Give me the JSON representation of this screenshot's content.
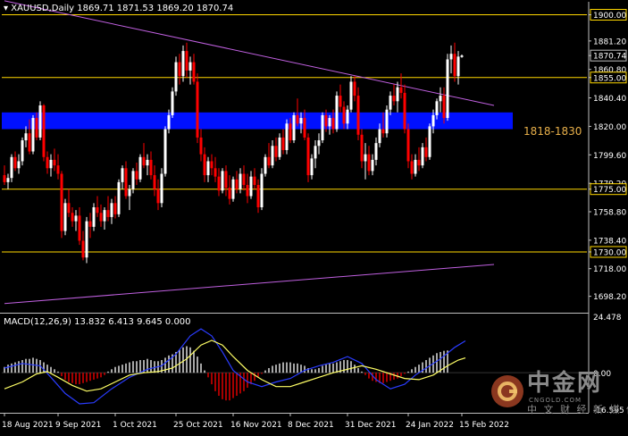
{
  "header": {
    "symbol": "XAUUSD,Daily",
    "ohlc": "1869.71 1871.53 1869.20 1870.74"
  },
  "macd": {
    "label": "MACD(12,26,9) 13.832 6.413 9.645 0.000",
    "axis_top": "24.478",
    "axis_zero": "0.00",
    "axis_bottom": "-16.595"
  },
  "zone_label": "1818-1830",
  "watermark": {
    "main": "中金网",
    "site": "CNGOLD.COM",
    "sub": "中 文 财 经 新 媒 体"
  },
  "colors": {
    "background": "#000000",
    "bull": "#ffffff",
    "bear": "#ff0000",
    "level_line": "#ffd700",
    "trendline": "#c060e0",
    "zone": "#0010ff",
    "macd_hist": "#ffffff",
    "macd_hist_neg": "#ff0000",
    "macd_line": "#2a3cff",
    "signal_line": "#ffff66"
  },
  "chart_data": {
    "type": "candlestick",
    "y_range": [
      1689,
      1908
    ],
    "price_ticks": [
      "1900.00",
      "1881.20",
      "1870.74",
      "1860.80",
      "1855.00",
      "1840.40",
      "1820.00",
      "1799.60",
      "1779.20",
      "1775.00",
      "1758.80",
      "1738.40",
      "1730.00",
      "1718.00",
      "1698.20"
    ],
    "levels": [
      1900,
      1855,
      1775,
      1730
    ],
    "level_labels": [
      "1900.00",
      "1855.00",
      "1775.00",
      "1730.00"
    ],
    "current_price": 1870.74,
    "current_price_label": "1870.74",
    "zone": {
      "low": 1818,
      "high": 1830,
      "label": "1818-1830"
    },
    "trendlines": [
      {
        "from_bar": 0,
        "from_price": 1910,
        "to_bar": 137,
        "to_price": 1835
      },
      {
        "from_bar": 0,
        "from_price": 1693,
        "to_bar": 137,
        "to_price": 1721
      }
    ],
    "x_ticks": [
      {
        "bar": 0,
        "label": "18 Aug 2021"
      },
      {
        "bar": 15,
        "label": "9 Sep 2021"
      },
      {
        "bar": 31,
        "label": "1 Oct 2021"
      },
      {
        "bar": 48,
        "label": "25 Oct 2021"
      },
      {
        "bar": 64,
        "label": "16 Nov 2021"
      },
      {
        "bar": 80,
        "label": "8 Dec 2021"
      },
      {
        "bar": 96,
        "label": "31 Dec 2021"
      },
      {
        "bar": 113,
        "label": "24 Jan 2022"
      },
      {
        "bar": 128,
        "label": "15 Feb 2022"
      }
    ],
    "candles": [
      [
        1785,
        1792,
        1778,
        1780
      ],
      [
        1780,
        1786,
        1775,
        1783
      ],
      [
        1783,
        1800,
        1780,
        1798
      ],
      [
        1798,
        1802,
        1788,
        1790
      ],
      [
        1790,
        1800,
        1786,
        1795
      ],
      [
        1795,
        1812,
        1792,
        1810
      ],
      [
        1810,
        1820,
        1805,
        1815
      ],
      [
        1815,
        1825,
        1800,
        1802
      ],
      [
        1802,
        1828,
        1800,
        1826
      ],
      [
        1826,
        1830,
        1810,
        1812
      ],
      [
        1812,
        1838,
        1810,
        1835
      ],
      [
        1835,
        1836,
        1795,
        1798
      ],
      [
        1798,
        1802,
        1786,
        1790
      ],
      [
        1790,
        1800,
        1784,
        1796
      ],
      [
        1796,
        1804,
        1788,
        1792
      ],
      [
        1792,
        1800,
        1782,
        1786
      ],
      [
        1786,
        1788,
        1740,
        1745
      ],
      [
        1745,
        1768,
        1742,
        1765
      ],
      [
        1765,
        1775,
        1755,
        1758
      ],
      [
        1758,
        1762,
        1748,
        1752
      ],
      [
        1752,
        1760,
        1745,
        1756
      ],
      [
        1756,
        1762,
        1735,
        1738
      ],
      [
        1738,
        1745,
        1724,
        1726
      ],
      [
        1726,
        1755,
        1722,
        1752
      ],
      [
        1752,
        1758,
        1740,
        1748
      ],
      [
        1748,
        1765,
        1745,
        1762
      ],
      [
        1762,
        1770,
        1755,
        1758
      ],
      [
        1758,
        1764,
        1748,
        1752
      ],
      [
        1752,
        1762,
        1746,
        1760
      ],
      [
        1760,
        1770,
        1752,
        1755
      ],
      [
        1755,
        1768,
        1750,
        1765
      ],
      [
        1765,
        1770,
        1754,
        1757
      ],
      [
        1757,
        1782,
        1755,
        1780
      ],
      [
        1780,
        1792,
        1775,
        1790
      ],
      [
        1790,
        1795,
        1768,
        1770
      ],
      [
        1770,
        1778,
        1760,
        1775
      ],
      [
        1775,
        1790,
        1772,
        1788
      ],
      [
        1788,
        1794,
        1778,
        1782
      ],
      [
        1782,
        1800,
        1780,
        1798
      ],
      [
        1798,
        1808,
        1790,
        1792
      ],
      [
        1792,
        1800,
        1785,
        1796
      ],
      [
        1796,
        1802,
        1782,
        1785
      ],
      [
        1785,
        1792,
        1770,
        1775
      ],
      [
        1775,
        1782,
        1760,
        1765
      ],
      [
        1765,
        1790,
        1762,
        1786
      ],
      [
        1786,
        1820,
        1784,
        1818
      ],
      [
        1818,
        1832,
        1815,
        1828
      ],
      [
        1828,
        1848,
        1826,
        1845
      ],
      [
        1845,
        1870,
        1842,
        1866
      ],
      [
        1866,
        1872,
        1850,
        1856
      ],
      [
        1856,
        1878,
        1852,
        1874
      ],
      [
        1874,
        1880,
        1855,
        1860
      ],
      [
        1860,
        1870,
        1850,
        1866
      ],
      [
        1866,
        1872,
        1850,
        1852
      ],
      [
        1852,
        1858,
        1808,
        1812
      ],
      [
        1812,
        1818,
        1795,
        1800
      ],
      [
        1800,
        1805,
        1780,
        1785
      ],
      [
        1785,
        1798,
        1780,
        1795
      ],
      [
        1795,
        1800,
        1785,
        1790
      ],
      [
        1790,
        1798,
        1780,
        1784
      ],
      [
        1784,
        1790,
        1770,
        1774
      ],
      [
        1774,
        1790,
        1772,
        1788
      ],
      [
        1788,
        1792,
        1770,
        1776
      ],
      [
        1776,
        1785,
        1764,
        1768
      ],
      [
        1768,
        1784,
        1766,
        1782
      ],
      [
        1782,
        1788,
        1772,
        1775
      ],
      [
        1775,
        1790,
        1772,
        1786
      ],
      [
        1786,
        1792,
        1774,
        1778
      ],
      [
        1778,
        1786,
        1765,
        1770
      ],
      [
        1770,
        1788,
        1768,
        1784
      ],
      [
        1784,
        1790,
        1775,
        1778
      ],
      [
        1778,
        1782,
        1758,
        1762
      ],
      [
        1762,
        1790,
        1760,
        1786
      ],
      [
        1786,
        1800,
        1784,
        1798
      ],
      [
        1798,
        1808,
        1790,
        1792
      ],
      [
        1792,
        1810,
        1790,
        1806
      ],
      [
        1806,
        1812,
        1795,
        1798
      ],
      [
        1798,
        1815,
        1796,
        1812
      ],
      [
        1812,
        1818,
        1800,
        1803
      ],
      [
        1803,
        1825,
        1800,
        1822
      ],
      [
        1822,
        1826,
        1808,
        1810
      ],
      [
        1810,
        1830,
        1808,
        1828
      ],
      [
        1828,
        1840,
        1820,
        1822
      ],
      [
        1822,
        1830,
        1815,
        1826
      ],
      [
        1826,
        1832,
        1810,
        1812
      ],
      [
        1812,
        1815,
        1780,
        1785
      ],
      [
        1785,
        1800,
        1782,
        1797
      ],
      [
        1797,
        1810,
        1790,
        1806
      ],
      [
        1806,
        1815,
        1800,
        1810
      ],
      [
        1810,
        1830,
        1808,
        1828
      ],
      [
        1828,
        1832,
        1816,
        1820
      ],
      [
        1820,
        1828,
        1814,
        1826
      ],
      [
        1826,
        1832,
        1815,
        1818
      ],
      [
        1818,
        1845,
        1816,
        1842
      ],
      [
        1842,
        1850,
        1830,
        1834
      ],
      [
        1834,
        1838,
        1818,
        1822
      ],
      [
        1822,
        1835,
        1818,
        1832
      ],
      [
        1832,
        1856,
        1830,
        1852
      ],
      [
        1852,
        1856,
        1838,
        1842
      ],
      [
        1842,
        1848,
        1810,
        1814
      ],
      [
        1814,
        1818,
        1790,
        1795
      ],
      [
        1795,
        1808,
        1782,
        1800
      ],
      [
        1800,
        1806,
        1785,
        1788
      ],
      [
        1788,
        1800,
        1785,
        1796
      ],
      [
        1796,
        1812,
        1792,
        1808
      ],
      [
        1808,
        1822,
        1805,
        1818
      ],
      [
        1818,
        1830,
        1812,
        1815
      ],
      [
        1815,
        1835,
        1812,
        1832
      ],
      [
        1832,
        1845,
        1828,
        1842
      ],
      [
        1842,
        1850,
        1835,
        1838
      ],
      [
        1838,
        1852,
        1830,
        1848
      ],
      [
        1848,
        1858,
        1840,
        1844
      ],
      [
        1844,
        1850,
        1815,
        1818
      ],
      [
        1818,
        1822,
        1790,
        1795
      ],
      [
        1795,
        1800,
        1782,
        1786
      ],
      [
        1786,
        1800,
        1784,
        1796
      ],
      [
        1796,
        1805,
        1788,
        1792
      ],
      [
        1792,
        1808,
        1790,
        1805
      ],
      [
        1805,
        1812,
        1795,
        1798
      ],
      [
        1798,
        1822,
        1796,
        1820
      ],
      [
        1820,
        1832,
        1815,
        1828
      ],
      [
        1828,
        1840,
        1825,
        1838
      ],
      [
        1838,
        1848,
        1830,
        1842
      ],
      [
        1842,
        1848,
        1822,
        1826
      ],
      [
        1826,
        1872,
        1824,
        1868
      ],
      [
        1868,
        1878,
        1858,
        1872
      ],
      [
        1872,
        1880,
        1852,
        1856
      ],
      [
        1856,
        1874,
        1850,
        1870
      ],
      [
        1869.71,
        1871.53,
        1869.2,
        1870.74
      ]
    ],
    "macd_histogram": [
      2.5,
      3.5,
      4.0,
      4.5,
      5.0,
      5.5,
      6.0,
      6.0,
      6.5,
      6.0,
      5.5,
      4.5,
      3.5,
      2.5,
      1.5,
      0.5,
      -1.5,
      -3.0,
      -4.0,
      -4.5,
      -5.0,
      -5.0,
      -4.5,
      -4.0,
      -3.5,
      -3.0,
      -2.5,
      -2.0,
      -1.0,
      0.5,
      1.5,
      2.5,
      3.0,
      3.5,
      4.0,
      4.5,
      5.0,
      5.0,
      5.5,
      5.5,
      6.0,
      5.5,
      5.0,
      5.0,
      5.5,
      6.5,
      7.5,
      8.0,
      9.0,
      10.0,
      11.0,
      11.5,
      11.0,
      9.5,
      7.0,
      4.0,
      1.0,
      -2.0,
      -5.0,
      -8.0,
      -10.0,
      -11.5,
      -12.0,
      -12.0,
      -11.0,
      -10.0,
      -9.0,
      -8.0,
      -6.5,
      -5.0,
      -3.5,
      -2.0,
      -0.5,
      1.0,
      2.0,
      3.0,
      3.5,
      4.0,
      4.5,
      4.5,
      4.5,
      4.0,
      4.0,
      3.5,
      3.0,
      2.0,
      1.5,
      1.5,
      2.0,
      3.0,
      3.5,
      4.0,
      4.0,
      4.5,
      5.0,
      5.5,
      5.5,
      5.0,
      3.5,
      2.0,
      0.5,
      -1.0,
      -2.5,
      -3.5,
      -4.0,
      -4.5,
      -4.5,
      -4.0,
      -3.5,
      -3.0,
      -2.5,
      -1.5,
      -0.5,
      0.5,
      1.5,
      2.5,
      3.5,
      4.5,
      5.5,
      6.5,
      7.5,
      8.5,
      9.0,
      9.5,
      9.645
    ],
    "macd_line_points": [
      [
        0,
        2.0
      ],
      [
        5,
        4.0
      ],
      [
        10,
        3.0
      ],
      [
        13,
        -2.0
      ],
      [
        17,
        -9.0
      ],
      [
        21,
        -13.5
      ],
      [
        25,
        -13.0
      ],
      [
        30,
        -7.0
      ],
      [
        35,
        -2.0
      ],
      [
        40,
        1.5
      ],
      [
        44,
        3.0
      ],
      [
        48,
        8.0
      ],
      [
        52,
        16.0
      ],
      [
        55,
        19.0
      ],
      [
        58,
        16.0
      ],
      [
        61,
        9.0
      ],
      [
        64,
        1.0
      ],
      [
        68,
        -4.0
      ],
      [
        72,
        -6.0
      ],
      [
        76,
        -4.0
      ],
      [
        80,
        -2.5
      ],
      [
        84,
        1.0
      ],
      [
        88,
        3.0
      ],
      [
        92,
        4.5
      ],
      [
        96,
        7.0
      ],
      [
        100,
        4.0
      ],
      [
        104,
        -3.0
      ],
      [
        108,
        -7.0
      ],
      [
        112,
        -5.0
      ],
      [
        115,
        -1.0
      ],
      [
        118,
        2.0
      ],
      [
        122,
        6.0
      ],
      [
        126,
        11.0
      ],
      [
        129,
        13.832
      ]
    ],
    "signal_line_points": [
      [
        0,
        -7.0
      ],
      [
        5,
        -4.0
      ],
      [
        9,
        -0.5
      ],
      [
        12,
        0.5
      ],
      [
        15,
        -2.0
      ],
      [
        19,
        -5.5
      ],
      [
        23,
        -8.0
      ],
      [
        27,
        -7.0
      ],
      [
        31,
        -4.0
      ],
      [
        35,
        -1.0
      ],
      [
        39,
        0.0
      ],
      [
        43,
        0.5
      ],
      [
        47,
        2.0
      ],
      [
        51,
        6.0
      ],
      [
        55,
        12.0
      ],
      [
        58,
        14.0
      ],
      [
        61,
        12.0
      ],
      [
        64,
        7.0
      ],
      [
        68,
        1.0
      ],
      [
        72,
        -3.0
      ],
      [
        76,
        -6.0
      ],
      [
        80,
        -6.0
      ],
      [
        84,
        -4.0
      ],
      [
        88,
        -2.0
      ],
      [
        92,
        0.0
      ],
      [
        96,
        1.5
      ],
      [
        100,
        3.0
      ],
      [
        104,
        1.5
      ],
      [
        108,
        -0.5
      ],
      [
        112,
        -2.5
      ],
      [
        116,
        -3.0
      ],
      [
        120,
        -1.0
      ],
      [
        124,
        3.0
      ],
      [
        127,
        5.5
      ],
      [
        129,
        6.413
      ]
    ],
    "macd_range": [
      -16.595,
      24.478
    ],
    "series": [
      {
        "name": "MACD(12,26,9)"
      }
    ]
  }
}
